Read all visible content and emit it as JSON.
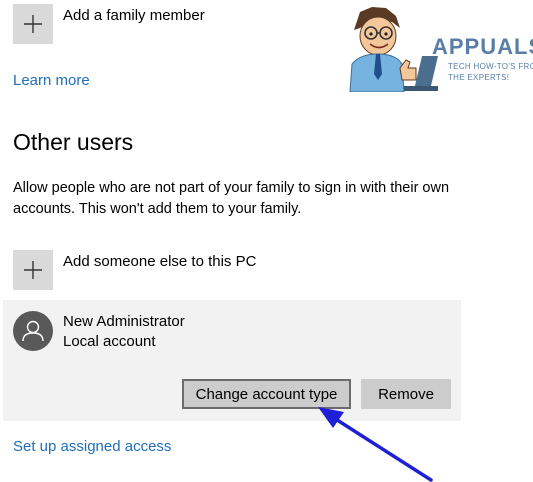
{
  "family": {
    "add_label": "Add a family member",
    "learn_more": "Learn more"
  },
  "other_users": {
    "title": "Other users",
    "description": "Allow people who are not part of your family to sign in with their own accounts. This won't add them to your family.",
    "add_label": "Add someone else to this PC"
  },
  "account": {
    "name": "New Administrator",
    "type": "Local account",
    "change_button": "Change account type",
    "remove_button": "Remove"
  },
  "assigned_access_link": "Set up assigned access",
  "watermark": {
    "brand": "APPUALS",
    "tagline_1": "TECH HOW-TO'S FROM",
    "tagline_2": "THE EXPERTS!"
  },
  "colors": {
    "link": "#1f6fb8",
    "tile": "#d9d9d9",
    "panel": "#f2f2f2",
    "button": "#cccccc",
    "avatar": "#595959",
    "arrow": "#1f1fd6",
    "watermark": "#5b7ea6"
  },
  "icons": {
    "add_tile": "plus-icon",
    "avatar": "person-icon",
    "annotation": "arrow-icon"
  }
}
